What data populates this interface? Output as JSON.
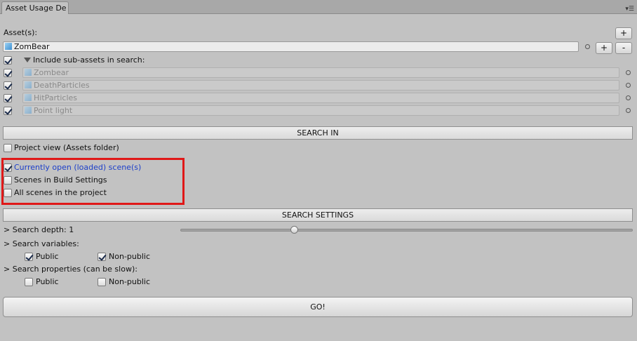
{
  "tab": {
    "title": "Asset Usage De"
  },
  "assets": {
    "label": "Asset(s):",
    "add_label": "+",
    "main_asset": "ZomBear",
    "row_add_label": "+",
    "row_remove_label": "-",
    "sub_toggle_label": "Include sub-assets in search:",
    "sub_assets": [
      "Zombear",
      "DeathParticles",
      "HitParticles",
      "Point light"
    ]
  },
  "search_in": {
    "header": "SEARCH IN",
    "project_view": "Project view (Assets folder)",
    "open_scenes": "Currently open (loaded) scene(s)",
    "build_scenes": "Scenes in Build Settings",
    "all_scenes": "All scenes in the project"
  },
  "settings": {
    "header": "SEARCH SETTINGS",
    "depth_label": "> Search depth: 1",
    "depth_value": 1,
    "variables_label": "> Search variables:",
    "properties_label": "> Search properties (can be slow):",
    "public": "Public",
    "non_public": "Non-public",
    "variables_public": true,
    "variables_nonpublic": true,
    "properties_public": false,
    "properties_nonpublic": false
  },
  "go_label": "GO!"
}
